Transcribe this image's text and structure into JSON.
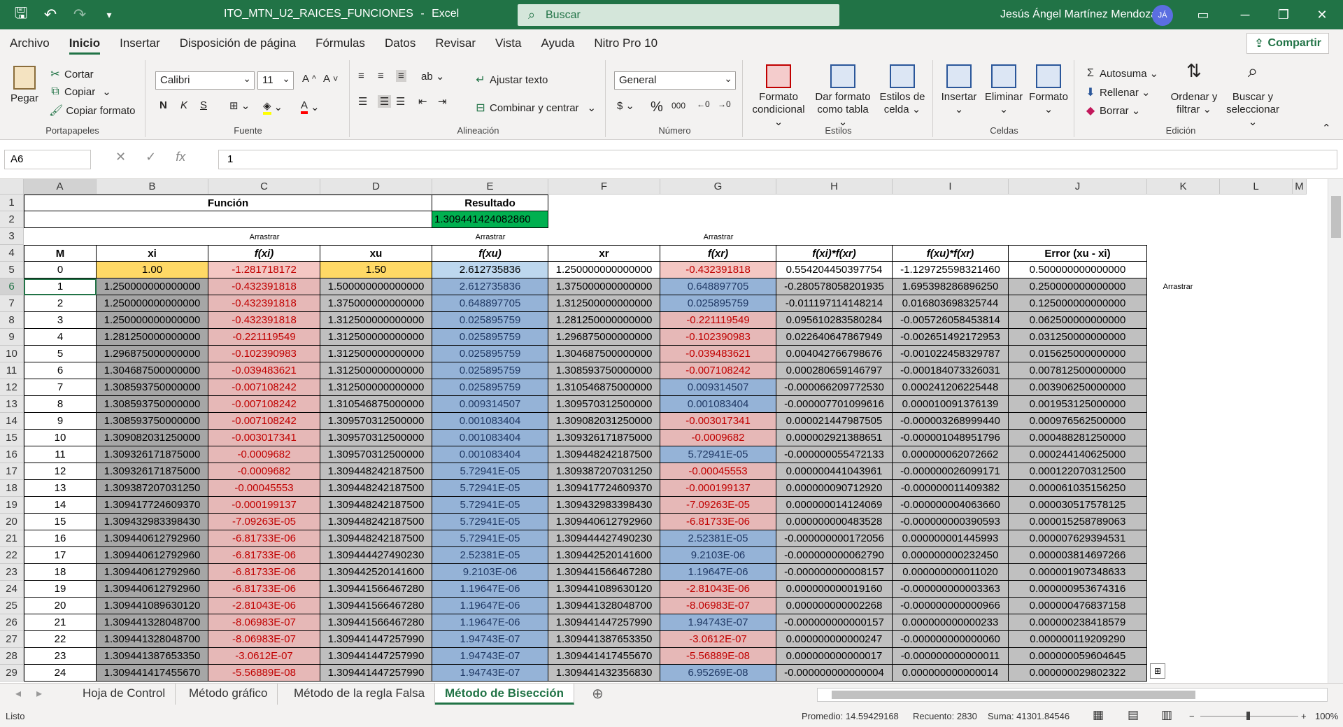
{
  "titlebar": {
    "filename": "ITO_MTN_U2_RAICES_FUNCIONES",
    "sep": "-",
    "app": "Excel",
    "search_placeholder": "Buscar",
    "user": "Jesús Ángel Martínez Mendoza",
    "avatar": "JÁ"
  },
  "menu": {
    "tabs": [
      "Archivo",
      "Inicio",
      "Insertar",
      "Disposición de página",
      "Fórmulas",
      "Datos",
      "Revisar",
      "Vista",
      "Ayuda",
      "Nitro Pro 10"
    ],
    "share": "Compartir"
  },
  "ribbon": {
    "portapapeles": {
      "label": "Portapapeles",
      "paste": "Pegar",
      "cut": "Cortar",
      "copy": "Copiar",
      "format_painter": "Copiar formato"
    },
    "fuente": {
      "label": "Fuente",
      "font": "Calibri",
      "size": "11",
      "bold": "N",
      "italic": "K",
      "underline": "S"
    },
    "alineacion": {
      "label": "Alineación",
      "wrap": "Ajustar texto",
      "merge": "Combinar y centrar"
    },
    "numero": {
      "label": "Número",
      "format": "General",
      "currency": "$",
      "percent": "%",
      "thousands": "000"
    },
    "estilos": {
      "label": "Estilos",
      "cond_line1": "Formato",
      "cond_line2": "condicional",
      "table_line1": "Dar formato",
      "table_line2": "como tabla",
      "cell_line1": "Estilos de",
      "cell_line2": "celda"
    },
    "celdas": {
      "label": "Celdas",
      "insert": "Insertar",
      "delete": "Eliminar",
      "format": "Formato"
    },
    "edicion": {
      "label": "Edición",
      "autosum": "Autosuma",
      "fill": "Rellenar",
      "clear": "Borrar",
      "sort_line1": "Ordenar y",
      "sort_line2": "filtrar",
      "find_line1": "Buscar y",
      "find_line2": "seleccionar"
    }
  },
  "formula_bar": {
    "name_box": "A6",
    "fx": "fx",
    "value": "1"
  },
  "sheet": {
    "columns": [
      "A",
      "B",
      "C",
      "D",
      "E",
      "F",
      "G",
      "H",
      "I",
      "J",
      "K",
      "L",
      "M"
    ],
    "row1": {
      "funcion": "Función",
      "resultado": "Resultado"
    },
    "row2": {
      "resultado_value": "1.309441424082860"
    },
    "row3": {
      "arrastrar": "Arrastrar"
    },
    "arrastrar_side": "Arrastrar",
    "headers": [
      "M",
      "xi",
      "f(xi)",
      "xu",
      "f(xu)",
      "xr",
      "f(xr)",
      "f(xi)*f(xr)",
      "f(xu)*f(xr)",
      "Error (xu - xi)"
    ],
    "rows": [
      [
        "0",
        "1.00",
        "-1.281718172",
        "1.50",
        "2.612735836",
        "1.250000000000000",
        "-0.432391818",
        "0.554204450397754",
        "-1.129725598321460",
        "0.500000000000000"
      ],
      [
        "1",
        "1.250000000000000",
        "-0.432391818",
        "1.500000000000000",
        "2.612735836",
        "1.375000000000000",
        "0.648897705",
        "-0.280578058201935",
        "1.695398286896250",
        "0.250000000000000"
      ],
      [
        "2",
        "1.250000000000000",
        "-0.432391818",
        "1.375000000000000",
        "0.648897705",
        "1.312500000000000",
        "0.025895759",
        "-0.011197114148214",
        "0.016803698325744",
        "0.125000000000000"
      ],
      [
        "3",
        "1.250000000000000",
        "-0.432391818",
        "1.312500000000000",
        "0.025895759",
        "1.281250000000000",
        "-0.221119549",
        "0.095610283580284",
        "-0.005726058453814",
        "0.062500000000000"
      ],
      [
        "4",
        "1.281250000000000",
        "-0.221119549",
        "1.312500000000000",
        "0.025895759",
        "1.296875000000000",
        "-0.102390983",
        "0.022640647867949",
        "-0.002651492172953",
        "0.031250000000000"
      ],
      [
        "5",
        "1.296875000000000",
        "-0.102390983",
        "1.312500000000000",
        "0.025895759",
        "1.304687500000000",
        "-0.039483621",
        "0.004042766798676",
        "-0.001022458329787",
        "0.015625000000000"
      ],
      [
        "6",
        "1.304687500000000",
        "-0.039483621",
        "1.312500000000000",
        "0.025895759",
        "1.308593750000000",
        "-0.007108242",
        "0.000280659146797",
        "-0.000184073326031",
        "0.007812500000000"
      ],
      [
        "7",
        "1.308593750000000",
        "-0.007108242",
        "1.312500000000000",
        "0.025895759",
        "1.310546875000000",
        "0.009314507",
        "-0.000066209772530",
        "0.000241206225448",
        "0.003906250000000"
      ],
      [
        "8",
        "1.308593750000000",
        "-0.007108242",
        "1.310546875000000",
        "0.009314507",
        "1.309570312500000",
        "0.001083404",
        "-0.000007701099616",
        "0.000010091376139",
        "0.001953125000000"
      ],
      [
        "9",
        "1.308593750000000",
        "-0.007108242",
        "1.309570312500000",
        "0.001083404",
        "1.309082031250000",
        "-0.003017341",
        "0.000021447987505",
        "-0.000003268999440",
        "0.000976562500000"
      ],
      [
        "10",
        "1.309082031250000",
        "-0.003017341",
        "1.309570312500000",
        "0.001083404",
        "1.309326171875000",
        "-0.0009682",
        "0.000002921388651",
        "-0.000001048951796",
        "0.000488281250000"
      ],
      [
        "11",
        "1.309326171875000",
        "-0.0009682",
        "1.309570312500000",
        "0.001083404",
        "1.309448242187500",
        "5.72941E-05",
        "-0.000000055472133",
        "0.000000062072662",
        "0.000244140625000"
      ],
      [
        "12",
        "1.309326171875000",
        "-0.0009682",
        "1.309448242187500",
        "5.72941E-05",
        "1.309387207031250",
        "-0.00045553",
        "0.000000441043961",
        "-0.000000026099171",
        "0.000122070312500"
      ],
      [
        "13",
        "1.309387207031250",
        "-0.00045553",
        "1.309448242187500",
        "5.72941E-05",
        "1.309417724609370",
        "-0.000199137",
        "0.000000090712920",
        "-0.000000011409382",
        "0.000061035156250"
      ],
      [
        "14",
        "1.309417724609370",
        "-0.000199137",
        "1.309448242187500",
        "5.72941E-05",
        "1.309432983398430",
        "-7.09263E-05",
        "0.000000014124069",
        "-0.000000004063660",
        "0.000030517578125"
      ],
      [
        "15",
        "1.309432983398430",
        "-7.09263E-05",
        "1.309448242187500",
        "5.72941E-05",
        "1.309440612792960",
        "-6.81733E-06",
        "0.000000000483528",
        "-0.000000000390593",
        "0.000015258789063"
      ],
      [
        "16",
        "1.309440612792960",
        "-6.81733E-06",
        "1.309448242187500",
        "5.72941E-05",
        "1.309444427490230",
        "2.52381E-05",
        "-0.000000000172056",
        "0.000000001445993",
        "0.000007629394531"
      ],
      [
        "17",
        "1.309440612792960",
        "-6.81733E-06",
        "1.309444427490230",
        "2.52381E-05",
        "1.309442520141600",
        "9.2103E-06",
        "-0.000000000062790",
        "0.000000000232450",
        "0.000003814697266"
      ],
      [
        "18",
        "1.309440612792960",
        "-6.81733E-06",
        "1.309442520141600",
        "9.2103E-06",
        "1.309441566467280",
        "1.19647E-06",
        "-0.000000000008157",
        "0.000000000011020",
        "0.000001907348633"
      ],
      [
        "19",
        "1.309440612792960",
        "-6.81733E-06",
        "1.309441566467280",
        "1.19647E-06",
        "1.309441089630120",
        "-2.81043E-06",
        "0.000000000019160",
        "-0.000000000003363",
        "0.000000953674316"
      ],
      [
        "20",
        "1.309441089630120",
        "-2.81043E-06",
        "1.309441566467280",
        "1.19647E-06",
        "1.309441328048700",
        "-8.06983E-07",
        "0.000000000002268",
        "-0.000000000000966",
        "0.000000476837158"
      ],
      [
        "21",
        "1.309441328048700",
        "-8.06983E-07",
        "1.309441566467280",
        "1.19647E-06",
        "1.309441447257990",
        "1.94743E-07",
        "-0.000000000000157",
        "0.000000000000233",
        "0.000000238418579"
      ],
      [
        "22",
        "1.309441328048700",
        "-8.06983E-07",
        "1.309441447257990",
        "1.94743E-07",
        "1.309441387653350",
        "-3.0612E-07",
        "0.000000000000247",
        "-0.000000000000060",
        "0.000000119209290"
      ],
      [
        "23",
        "1.309441387653350",
        "-3.0612E-07",
        "1.309441447257990",
        "1.94743E-07",
        "1.309441417455670",
        "-5.56889E-08",
        "0.000000000000017",
        "-0.000000000000011",
        "0.000000059604645"
      ],
      [
        "24",
        "1.309441417455670",
        "-5.56889E-08",
        "1.309441447257990",
        "1.94743E-07",
        "1.309441432356830",
        "6.95269E-08",
        "-0.000000000000004",
        "0.000000000000014",
        "0.000000029802322"
      ]
    ]
  },
  "sheet_tabs": [
    "Hoja de Control",
    "Método gráfico",
    "Método de la regla Falsa",
    "Método de Bisección"
  ],
  "active_sheet": "Método de Bisección",
  "status": {
    "ready": "Listo",
    "average": "Promedio: 14.59429168",
    "count": "Recuento: 2830",
    "sum": "Suma: 41301.84546",
    "zoom": "100%"
  },
  "colors": {
    "accent": "#217346",
    "negative_fill": "#e6b8b7",
    "negative_text": "#c00000",
    "positive_fill": "#95b3d7",
    "xi_fill": "#ffd966",
    "highlight_green": "#00b050"
  }
}
